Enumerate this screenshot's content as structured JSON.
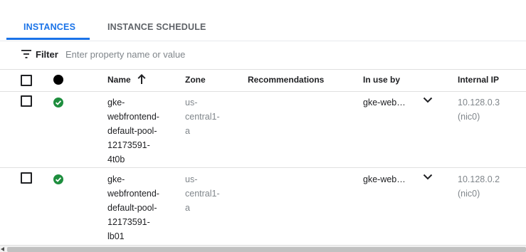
{
  "tabs": [
    {
      "label": "INSTANCES",
      "active": true
    },
    {
      "label": "INSTANCE SCHEDULE",
      "active": false
    }
  ],
  "filter": {
    "label": "Filter",
    "placeholder": "Enter property name or value",
    "icon": "filter-list-icon"
  },
  "table": {
    "columns": [
      "Name",
      "Zone",
      "Recommendations",
      "In use by",
      "Internal IP"
    ],
    "sort": {
      "column": "Name",
      "direction": "ascending"
    },
    "rows": [
      {
        "name": "gke-webfrontend-default-pool-12173591-4t0b",
        "name_lines": [
          "gke-",
          "webfrontend-",
          "default-pool-",
          "12173591-",
          "4t0b"
        ],
        "zone_lines": [
          "us-",
          "central1-",
          "a"
        ],
        "recommendations": "",
        "in_use_by": "gke-web…",
        "ip_lines": [
          "10.128.0.3",
          "(nic0)"
        ],
        "status": "running"
      },
      {
        "name": "gke-webfrontend-default-pool-12173591-lb01",
        "name_lines": [
          "gke-",
          "webfrontend-",
          "default-pool-",
          "12173591-",
          "lb01"
        ],
        "zone_lines": [
          "us-",
          "central1-",
          "a"
        ],
        "recommendations": "",
        "in_use_by": "gke-web…",
        "ip_lines": [
          "10.128.0.2",
          "(nic0)"
        ],
        "status": "running"
      }
    ]
  },
  "colors": {
    "accent": "#1a73e8",
    "status_ok": "#1e8e3e",
    "muted_text": "#80868b"
  }
}
